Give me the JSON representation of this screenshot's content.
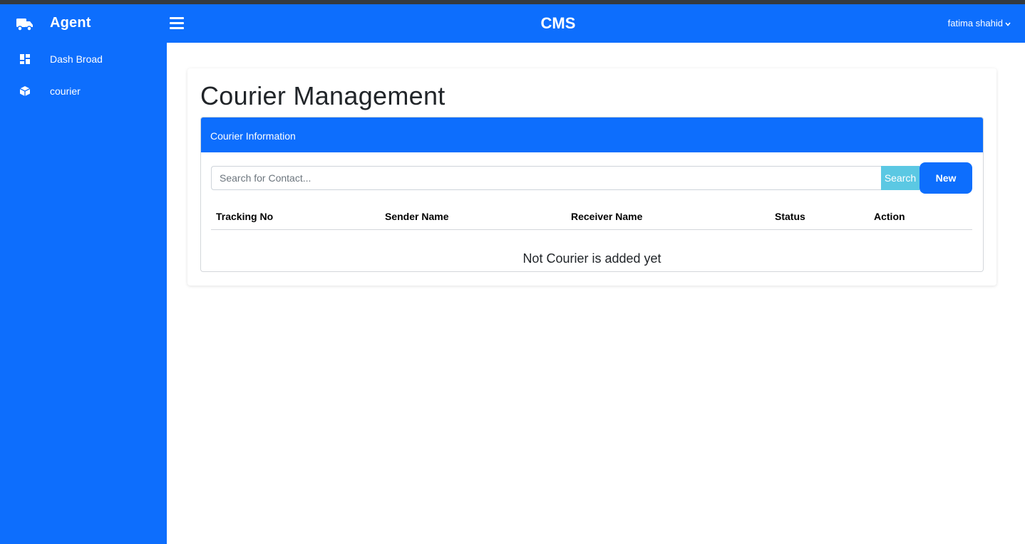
{
  "sidebar": {
    "brand": "Agent",
    "items": [
      {
        "label": "Dash Broad",
        "icon": "dashboard-icon"
      },
      {
        "label": "courier",
        "icon": "box-icon"
      }
    ]
  },
  "header": {
    "title": "CMS",
    "user": "fatima shahid"
  },
  "main": {
    "title": "Courier Management",
    "panel_title": "Courier Information",
    "search_placeholder": "Search for Contact...",
    "search_label": "Search",
    "new_label": "New",
    "columns": [
      "Tracking No",
      "Sender Name",
      "Receiver Name",
      "Status",
      "Action"
    ],
    "empty_message": "Not Courier is added yet"
  },
  "colors": {
    "primary": "#0d6efd",
    "info": "#5bc8e3",
    "dark": "#343a40"
  }
}
